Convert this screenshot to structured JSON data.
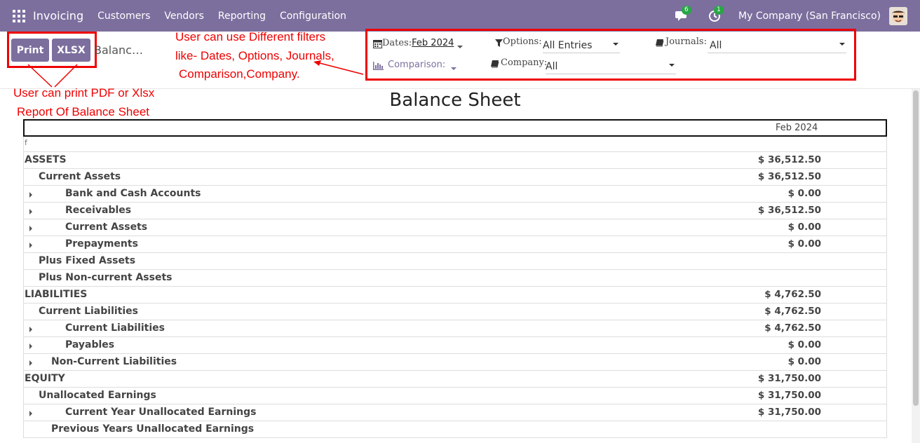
{
  "navbar": {
    "brand": "Invoicing",
    "menu": [
      "Customers",
      "Vendors",
      "Reporting",
      "Configuration"
    ],
    "messages_badge": "6",
    "activity_badge": "1",
    "company": "My Company (San Francisco)"
  },
  "control": {
    "print_label": "Print",
    "xlsx_label": "XLSX",
    "breadcrumb": "Balanc…"
  },
  "annotations": {
    "filters_line1": "User can use Different filters",
    "filters_line2": "like- Dates, Options, Journals,",
    "filters_line3": "Comparison,Company.",
    "print_line1": "User can print PDF or Xlsx",
    "print_line2": "Report Of Balance Sheet"
  },
  "filters": {
    "dates_label": "Dates:",
    "dates_value": "Feb 2024",
    "options_label": "Options:",
    "options_value": "All Entries",
    "journals_label": "Journals:",
    "journals_value": "All",
    "comparison_label": "Comparison:",
    "company_label": "Company:",
    "company_value": "All"
  },
  "report": {
    "title": "Balance Sheet",
    "column_header": "Feb 2024",
    "marker": "f",
    "rows": [
      {
        "name": "ASSETS",
        "value": "$ 36,512.50",
        "level": 0,
        "expand": false
      },
      {
        "name": "Current Assets",
        "value": "$ 36,512.50",
        "level": 1,
        "expand": false
      },
      {
        "name": "Bank and Cash Accounts",
        "value": "$ 0.00",
        "level": 3,
        "expand": true
      },
      {
        "name": "Receivables",
        "value": "$ 36,512.50",
        "level": 3,
        "expand": true
      },
      {
        "name": "Current Assets",
        "value": "$ 0.00",
        "level": 3,
        "expand": true
      },
      {
        "name": "Prepayments",
        "value": "$ 0.00",
        "level": 3,
        "expand": true
      },
      {
        "name": "Plus Fixed Assets",
        "value": "",
        "level": 1,
        "expand": false
      },
      {
        "name": "Plus Non-current Assets",
        "value": "",
        "level": 1,
        "expand": false
      },
      {
        "name": "LIABILITIES",
        "value": "$ 4,762.50",
        "level": 0,
        "expand": false
      },
      {
        "name": "Current Liabilities",
        "value": "$ 4,762.50",
        "level": 1,
        "expand": false
      },
      {
        "name": "Current Liabilities",
        "value": "$ 4,762.50",
        "level": 3,
        "expand": true
      },
      {
        "name": "Payables",
        "value": "$ 0.00",
        "level": 3,
        "expand": true
      },
      {
        "name": "Non-Current Liabilities",
        "value": "$ 0.00",
        "level": 2,
        "expand": true
      },
      {
        "name": "EQUITY",
        "value": "$ 31,750.00",
        "level": 0,
        "expand": false
      },
      {
        "name": "Unallocated Earnings",
        "value": "$ 31,750.00",
        "level": 1,
        "expand": false
      },
      {
        "name": "Current Year Unallocated Earnings",
        "value": "$ 31,750.00",
        "level": 3,
        "expand": true
      },
      {
        "name": "Previous Years Unallocated Earnings",
        "value": "",
        "level": 2,
        "expand": false
      }
    ]
  }
}
